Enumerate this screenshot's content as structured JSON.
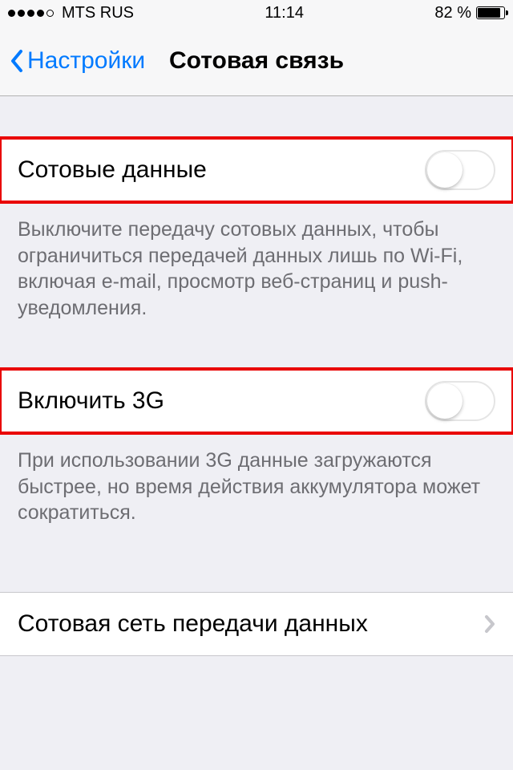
{
  "status_bar": {
    "carrier": "MTS RUS",
    "time": "11:14",
    "battery_pct": "82 %"
  },
  "nav": {
    "back_label": "Настройки",
    "title": "Сотовая связь"
  },
  "rows": {
    "cellular_data": {
      "label": "Сотовые данные",
      "on": false,
      "footer": "Выключите передачу сотовых данных, чтобы ограничиться передачей данных лишь по Wi-Fi, включая e-mail, просмотр веб-страниц и push-уведомления."
    },
    "enable_3g": {
      "label": "Включить 3G",
      "on": false,
      "footer": "При использовании 3G данные загружаются быстрее, но время действия аккумулятора может сократиться."
    },
    "cellular_network": {
      "label": "Сотовая сеть передачи данных"
    }
  }
}
